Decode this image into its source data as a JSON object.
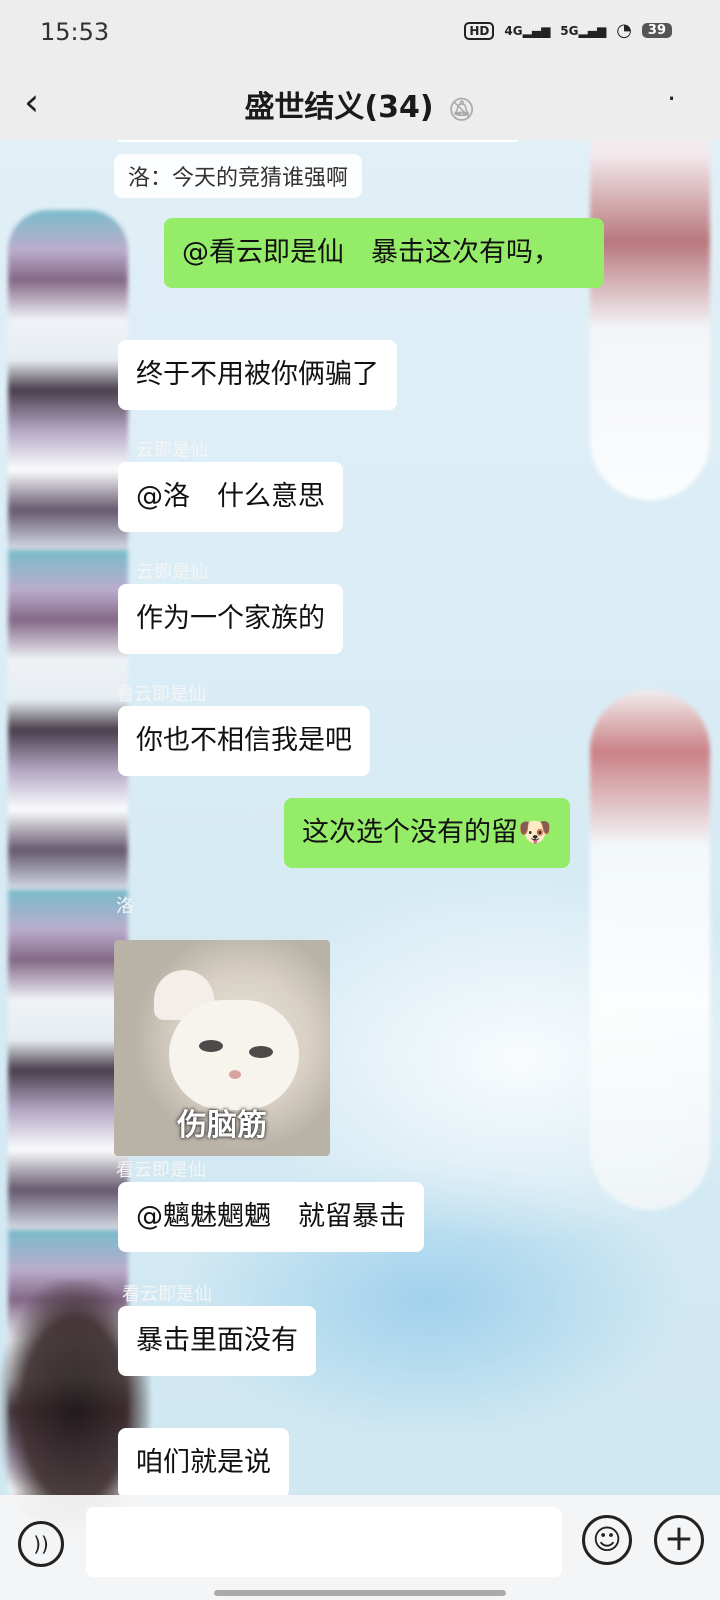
{
  "status_bar": {
    "time": "15:53",
    "hd_label": "HD",
    "signal_1": "4G",
    "signal_2": "5G",
    "battery": "39"
  },
  "header": {
    "title": "盛世结义(34)",
    "mute_icon": "bell-off-icon",
    "back_icon": "chevron-left-icon",
    "more_icon": "more-dots-icon"
  },
  "messages": [
    {
      "type": "system",
      "text": "洛：今天的竞猜谁强啊"
    },
    {
      "type": "outgoing",
      "text": "@看云即是仙　暴击这次有吗，"
    },
    {
      "type": "incoming",
      "sender": "",
      "text": "终于不用被你俩骗了"
    },
    {
      "type": "incoming",
      "sender": "云即是仙",
      "text": "@洛　什么意思"
    },
    {
      "type": "incoming",
      "sender": "云即是仙",
      "text": "作为一个家族的"
    },
    {
      "type": "incoming",
      "sender": "看云即是仙",
      "text": "你也不相信我是吧"
    },
    {
      "type": "outgoing",
      "text": "这次选个没有的留"
    },
    {
      "type": "sticker",
      "sender": "洛",
      "caption": "伤脑筋"
    },
    {
      "type": "incoming",
      "sender": "看云即是仙",
      "text": "@魑魅魍魉　就留暴击"
    },
    {
      "type": "incoming",
      "sender": "看云即是仙",
      "text": "暴击里面没有"
    },
    {
      "type": "incoming",
      "sender": "",
      "text": "咱们就是说"
    }
  ],
  "input_bar": {
    "voice_icon": "voice-icon",
    "emoji_icon": "emoji-icon",
    "plus_icon": "plus-icon",
    "input_value": ""
  }
}
